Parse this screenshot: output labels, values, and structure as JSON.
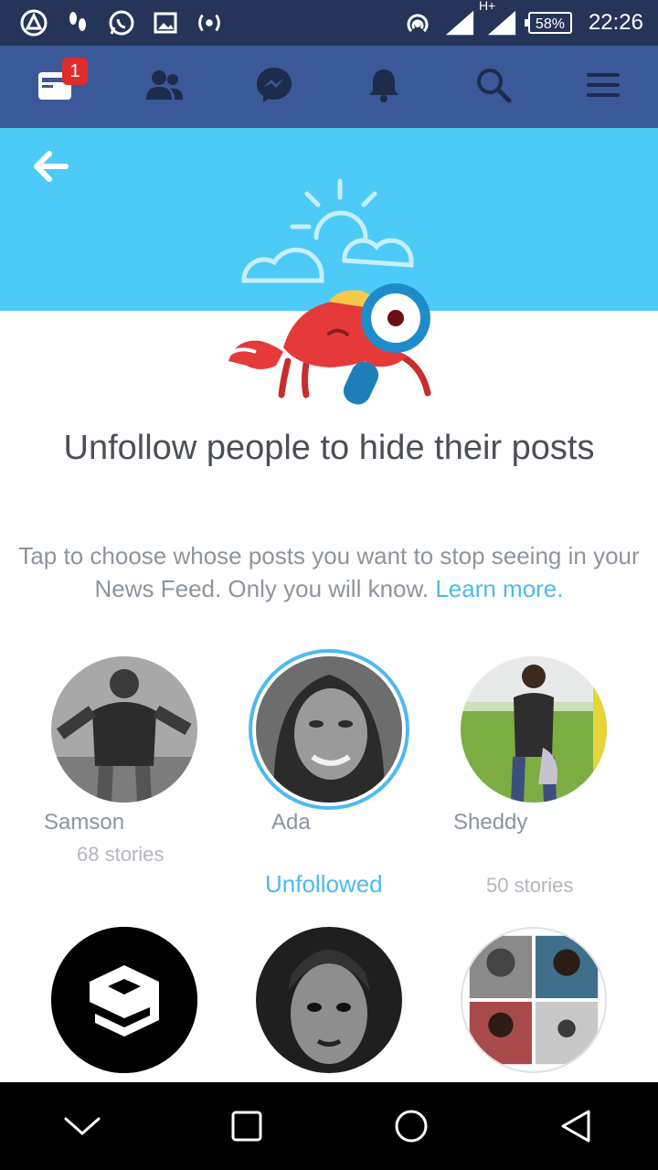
{
  "status_bar": {
    "left_icons": [
      "warning-triangle-icon",
      "footsteps-icon",
      "whatsapp-icon",
      "gallery-icon",
      "radio-signal-icon"
    ],
    "right_icons": [
      "hotspot-icon",
      "signal-icon",
      "hplus-signal-icon"
    ],
    "network_label": "H+",
    "battery": "58%",
    "time": "22:26"
  },
  "nav": {
    "items": [
      {
        "name": "news-feed",
        "icon": "news-feed-icon",
        "badge": "1"
      },
      {
        "name": "friends",
        "icon": "friends-icon"
      },
      {
        "name": "messenger",
        "icon": "messenger-icon"
      },
      {
        "name": "notifications",
        "icon": "bell-icon"
      },
      {
        "name": "search",
        "icon": "search-icon"
      },
      {
        "name": "menu",
        "icon": "hamburger-menu-icon"
      }
    ]
  },
  "page": {
    "title": "Unfollow people to hide their posts",
    "description": "Tap to choose whose posts you want to stop seeing in your News Feed. Only you will know.",
    "learn_more": "Learn more."
  },
  "people": [
    {
      "name": "Samson",
      "meta": "68 stories",
      "status": ""
    },
    {
      "name": "Ada",
      "meta": "",
      "status": "Unfollowed"
    },
    {
      "name": "Sheddy",
      "meta": "50 stories",
      "status": ""
    }
  ],
  "colors": {
    "status_bar": "#263459",
    "nav_bar": "#3b5998",
    "hero": "#4ccbf8",
    "accent": "#4cbaf0",
    "badge": "#e02c2c"
  }
}
